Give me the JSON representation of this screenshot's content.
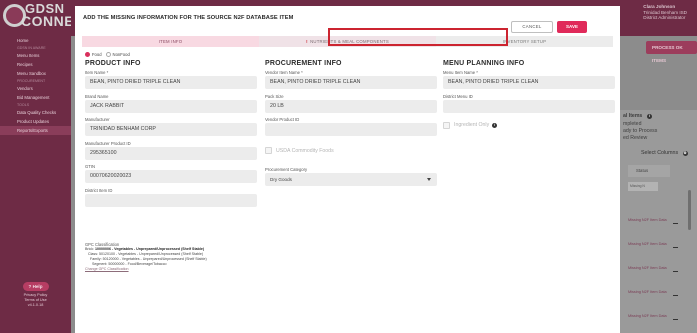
{
  "sidebar": {
    "logo_line1": "GDSN",
    "logo_line2": "CONNE",
    "items": [
      {
        "label": "Home",
        "dim": false,
        "active": false
      },
      {
        "label": "GDSN IN AWARE",
        "dim": true,
        "active": false
      },
      {
        "label": "Menu Items",
        "dim": false,
        "active": false
      },
      {
        "label": "Recipes",
        "dim": false,
        "active": false
      },
      {
        "label": "Menu Sandbox",
        "dim": false,
        "active": false
      },
      {
        "label": "PROCUREMENT",
        "dim": true,
        "active": false
      },
      {
        "label": "Vendors",
        "dim": false,
        "active": false
      },
      {
        "label": "Bid Management",
        "dim": false,
        "active": false
      },
      {
        "label": "TOOLS",
        "dim": true,
        "active": false
      },
      {
        "label": "Data Quality Checks",
        "dim": false,
        "active": false
      },
      {
        "label": "Product Updates",
        "dim": false,
        "active": false
      },
      {
        "label": "Reports/Exports",
        "dim": false,
        "active": true
      }
    ],
    "help_label": "Help",
    "privacy_label": "Privacy Policy",
    "terms_label": "Terms of Use",
    "version": "v4.1.0.18"
  },
  "header": {
    "user_name": "Clara Johnson",
    "user_line2": "Trinidad Benham ISD",
    "user_line3": "District Administrator"
  },
  "background": {
    "process_button": "PROCESS OK ITEMS",
    "lines": [
      "al Items",
      "mpleted",
      "ady to Process",
      "ed Review"
    ],
    "select_columns": "Select Columns",
    "status_header": "Status",
    "missing_select": "Missing N",
    "row_label": "Missing N2F Item Data"
  },
  "modal": {
    "title": "ADD THE MISSING INFORMATION FOR THE SOURCE N2F DATABASE ITEM",
    "cancel_label": "CANCEL",
    "save_label": "SAVE",
    "tabs": [
      {
        "label": "ITEM INFO",
        "state": "active"
      },
      {
        "label": "NUTRIENTS & MEAL COMPONENTS",
        "state": "warning"
      },
      {
        "label": "INVENTORY SETUP",
        "state": "inactive"
      }
    ],
    "food_option": "Food",
    "nonfood_option": "NonFood",
    "product_info": {
      "heading": "PRODUCT INFO",
      "item_name_label": "Item Name *",
      "item_name": "BEAN, PINTO DRIED TRIPLE CLEAN",
      "brand_label": "Brand Name",
      "brand": "JACK RABBIT",
      "manufacturer_label": "Manufacturer",
      "manufacturer": "TRINIDAD BENHAM CORP",
      "mfr_product_id_label": "Manufacturer Product ID",
      "mfr_product_id": "295365100",
      "gtin_label": "GTIN",
      "gtin": "00070620020023",
      "district_item_id_label": "District Item ID",
      "district_item_id": ""
    },
    "procurement_info": {
      "heading": "PROCUREMENT INFO",
      "vendor_item_name_label": "Vendor Item Name *",
      "vendor_item_name": "BEAN, PINTO DRIED TRIPLE CLEAN",
      "pack_size_label": "Pack Size",
      "pack_size": "20 LB",
      "vendor_product_id_label": "Vendor Product ID",
      "vendor_product_id": "",
      "usda_label": "USDA Commodity Foods",
      "category_label": "Procurement Category",
      "category": "Dry Goods"
    },
    "menu_planning_info": {
      "heading": "MENU PLANNING INFO",
      "menu_item_name_label": "Menu Item Name *",
      "menu_item_name": "BEAN, PINTO DRIED TRIPLE CLEAN",
      "district_menu_id_label": "District Menu ID",
      "district_menu_id": "",
      "ingredient_only_label": "Ingredient Only"
    },
    "gpc": {
      "heading": "GPC Classification",
      "brick_prefix": "Brick: ",
      "brick": "10000006 - Vegetables - Unprepared/Unprocessed (Shelf Stable)",
      "class_line": "Class: 50120100 - Vegetables - Unprepared/Unprocessed (Shelf Stable)",
      "family_line": "Family: 50120000 - Vegetables - Unprepared/Unprocessed (Shelf Stable)",
      "segment_line": "Segment: 50000000 - Food/Beverage/Tobacco",
      "change_link": "Change GPC Classification"
    }
  },
  "colors": {
    "brand": "#6e2b45",
    "accent": "#e02a5a",
    "highlight": "#cc2430"
  }
}
